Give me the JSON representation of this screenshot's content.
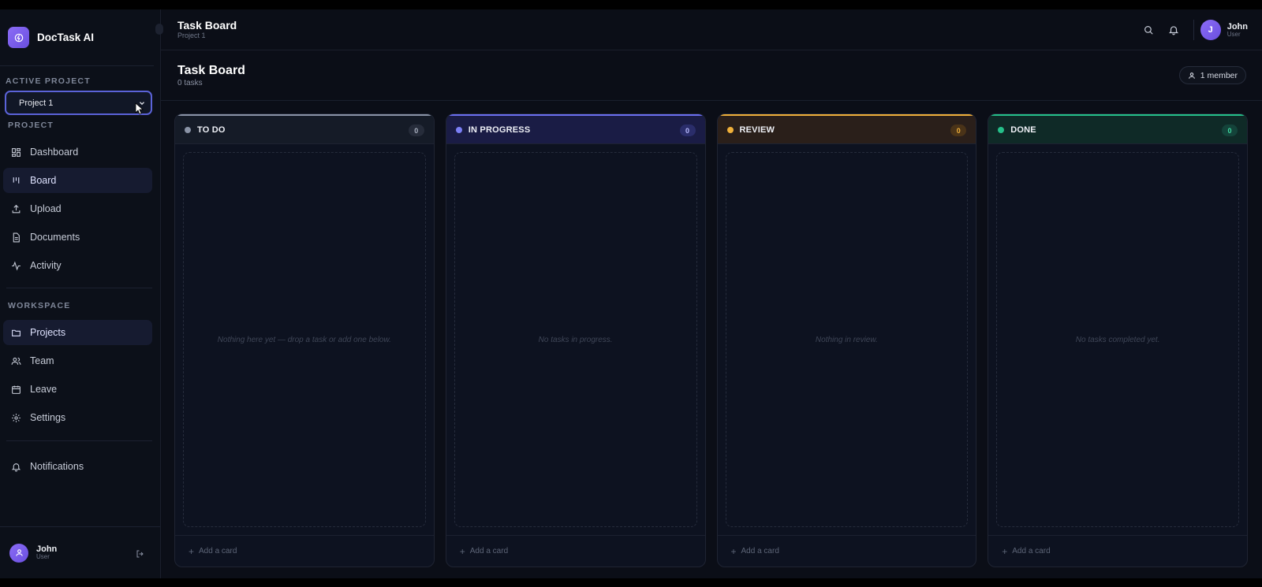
{
  "app": {
    "name": "DocTask AI"
  },
  "sidebar": {
    "active_project_label": "ACTIVE PROJECT",
    "selected_project": "Project 1",
    "project_section_label": "PROJECT",
    "project_items": [
      {
        "label": "Dashboard",
        "icon": "grid-icon"
      },
      {
        "label": "Board",
        "icon": "board-icon",
        "active": true
      },
      {
        "label": "Upload",
        "icon": "upload-icon"
      },
      {
        "label": "Documents",
        "icon": "document-icon"
      },
      {
        "label": "Activity",
        "icon": "activity-icon"
      }
    ],
    "workspace_section_label": "WORKSPACE",
    "workspace_items": [
      {
        "label": "Projects",
        "icon": "folder-icon",
        "active": true
      },
      {
        "label": "Team",
        "icon": "team-icon"
      },
      {
        "label": "Leave",
        "icon": "calendar-icon"
      },
      {
        "label": "Settings",
        "icon": "gear-icon"
      }
    ],
    "notifications_label": "Notifications",
    "user": {
      "name": "John",
      "role": "User"
    }
  },
  "topbar": {
    "title": "Task Board",
    "subtitle": "Project 1",
    "user": {
      "initial": "J",
      "name": "John",
      "role": "User"
    }
  },
  "page": {
    "title": "Task Board",
    "task_count": "0 tasks",
    "members": "1 member"
  },
  "columns": [
    {
      "title": "TO DO",
      "count": "0",
      "empty": "Nothing here yet — drop a task or add one below.",
      "add": "Add a card",
      "accent": "#8a93a6"
    },
    {
      "title": "IN PROGRESS",
      "count": "0",
      "empty": "No tasks in progress.",
      "add": "Add a card",
      "accent": "#6b6ff0"
    },
    {
      "title": "REVIEW",
      "count": "0",
      "empty": "Nothing in review.",
      "add": "Add a card",
      "accent": "#f0b03a"
    },
    {
      "title": "DONE",
      "count": "0",
      "empty": "No tasks completed yet.",
      "add": "Add a card",
      "accent": "#25c08a"
    }
  ]
}
